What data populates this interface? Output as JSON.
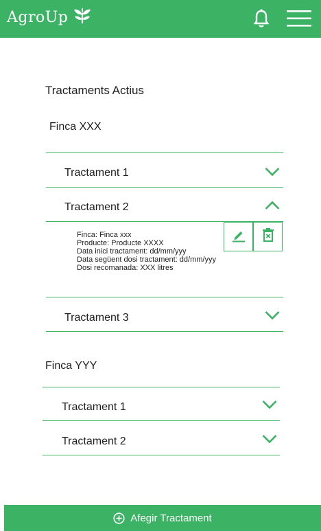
{
  "header": {
    "app_name": "AgroUp",
    "logo_icon": "leaf-icon",
    "bell_icon": "bell-icon",
    "menu_icon": "hamburger-menu-icon",
    "accent_color": "#3cb265"
  },
  "main": {
    "title": "Tractaments Actius",
    "farms": [
      {
        "name": "Finca XXX",
        "treatments": [
          {
            "label": "Tractament 1",
            "expanded": false
          },
          {
            "label": "Tractament 2",
            "expanded": true,
            "details": {
              "finca": "Finca: Finca  xxx",
              "producte": "Producte: Producte XXXX",
              "data_inici": "Data inici tractament: dd/mm/yyy",
              "data_seguent": "Data següent dosi tractament: dd/mm/yyy",
              "dosi": "Dosi recomanada: XXX litres"
            }
          },
          {
            "label": "Tractament 3",
            "expanded": false
          }
        ]
      },
      {
        "name": "Finca YYY",
        "treatments": [
          {
            "label": "Tractament 1",
            "expanded": false
          },
          {
            "label": "Tractament 2",
            "expanded": false
          }
        ]
      }
    ]
  },
  "actions": {
    "edit_icon": "pencil-icon",
    "delete_icon": "trash-icon"
  },
  "footer": {
    "add_label": "Afegir Tractament",
    "add_icon": "plus-circle-icon"
  }
}
